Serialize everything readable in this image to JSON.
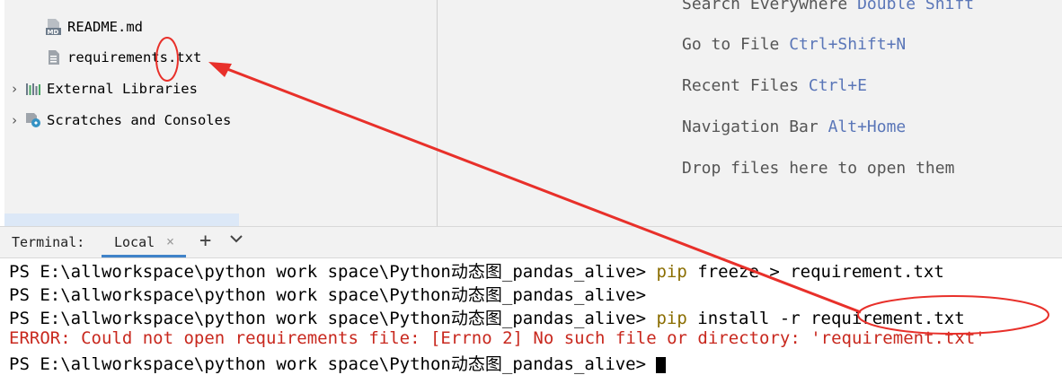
{
  "project_tree": {
    "items": [
      {
        "label": "README.md",
        "icon": "markdown-file-icon"
      },
      {
        "label": "requirements.txt",
        "icon": "text-file-icon"
      },
      {
        "label": "External Libraries",
        "icon": "libraries-icon"
      },
      {
        "label": "Scratches and Consoles",
        "icon": "scratches-icon"
      }
    ]
  },
  "editor_hints": [
    {
      "text": "Search Everywhere",
      "shortcut": "Double Shift"
    },
    {
      "text": "Go to File",
      "shortcut": "Ctrl+Shift+N"
    },
    {
      "text": "Recent Files",
      "shortcut": "Ctrl+E"
    },
    {
      "text": "Navigation Bar",
      "shortcut": "Alt+Home"
    },
    {
      "text": "Drop files here to open them",
      "shortcut": ""
    }
  ],
  "terminal": {
    "title": "Terminal:",
    "tab_label": "Local",
    "close_glyph": "×",
    "add_glyph": "+",
    "menu_glyph": "⌄",
    "lines": [
      {
        "prompt": "PS E:\\allworkspace\\python work space\\Python动态图_pandas_alive>",
        "cmd": "pip",
        "args": " freeze > requirement.txt"
      },
      {
        "prompt": "PS E:\\allworkspace\\python work space\\Python动态图_pandas_alive>",
        "cmd": "",
        "args": ""
      },
      {
        "prompt": "PS E:\\allworkspace\\python work space\\Python动态图_pandas_alive>",
        "cmd": "pip",
        "args": " install -r requirement.txt"
      },
      {
        "text": "ERROR: Could not open requirements file: [Errno 2] No such file or directory: 'requirement.txt'"
      },
      {
        "prompt": "PS E:\\allworkspace\\python work space\\Python动态图_pandas_alive>",
        "cmd": "",
        "args": ""
      }
    ]
  },
  "colors": {
    "shortcut": "#5a76b8",
    "command": "#8a6d00",
    "error": "#c8281e",
    "annotation": "#e8302a",
    "tab_underline": "#4083c9"
  }
}
